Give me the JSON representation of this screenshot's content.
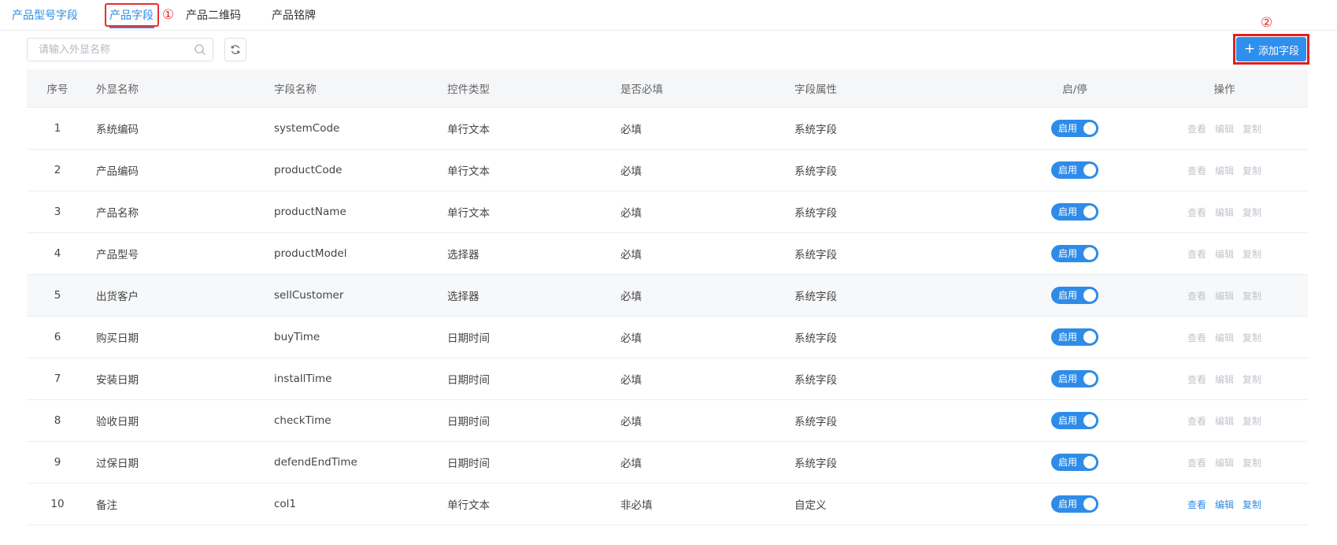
{
  "tabs": [
    {
      "label": "产品型号字段"
    },
    {
      "label": "产品字段"
    },
    {
      "label": "产品二维码"
    },
    {
      "label": "产品铭牌"
    }
  ],
  "annotations": {
    "marker1": "①",
    "marker2": "②"
  },
  "toolbar": {
    "search_placeholder": "请输入外显名称",
    "search_value": "",
    "add_label": "添加字段",
    "add_icon": "+"
  },
  "table": {
    "headers": [
      "序号",
      "外显名称",
      "字段名称",
      "控件类型",
      "是否必填",
      "字段属性",
      "启/停",
      "操作"
    ],
    "rows": [
      {
        "no": "1",
        "display": "系统编码",
        "field": "systemCode",
        "control": "单行文本",
        "required": "必填",
        "attr": "系统字段",
        "status": "启用",
        "ops": [
          "查看",
          "编辑",
          "复制"
        ],
        "editable": false
      },
      {
        "no": "2",
        "display": "产品编码",
        "field": "productCode",
        "control": "单行文本",
        "required": "必填",
        "attr": "系统字段",
        "status": "启用",
        "ops": [
          "查看",
          "编辑",
          "复制"
        ],
        "editable": false
      },
      {
        "no": "3",
        "display": "产品名称",
        "field": "productName",
        "control": "单行文本",
        "required": "必填",
        "attr": "系统字段",
        "status": "启用",
        "ops": [
          "查看",
          "编辑",
          "复制"
        ],
        "editable": false
      },
      {
        "no": "4",
        "display": "产品型号",
        "field": "productModel",
        "control": "选择器",
        "required": "必填",
        "attr": "系统字段",
        "status": "启用",
        "ops": [
          "查看",
          "编辑",
          "复制"
        ],
        "editable": false
      },
      {
        "no": "5",
        "display": "出货客户",
        "field": "sellCustomer",
        "control": "选择器",
        "required": "必填",
        "attr": "系统字段",
        "status": "启用",
        "ops": [
          "查看",
          "编辑",
          "复制"
        ],
        "editable": false
      },
      {
        "no": "6",
        "display": "购买日期",
        "field": "buyTime",
        "control": "日期时间",
        "required": "必填",
        "attr": "系统字段",
        "status": "启用",
        "ops": [
          "查看",
          "编辑",
          "复制"
        ],
        "editable": false
      },
      {
        "no": "7",
        "display": "安装日期",
        "field": "installTime",
        "control": "日期时间",
        "required": "必填",
        "attr": "系统字段",
        "status": "启用",
        "ops": [
          "查看",
          "编辑",
          "复制"
        ],
        "editable": false
      },
      {
        "no": "8",
        "display": "验收日期",
        "field": "checkTime",
        "control": "日期时间",
        "required": "必填",
        "attr": "系统字段",
        "status": "启用",
        "ops": [
          "查看",
          "编辑",
          "复制"
        ],
        "editable": false
      },
      {
        "no": "9",
        "display": "过保日期",
        "field": "defendEndTime",
        "control": "日期时间",
        "required": "必填",
        "attr": "系统字段",
        "status": "启用",
        "ops": [
          "查看",
          "编辑",
          "复制"
        ],
        "editable": false
      },
      {
        "no": "10",
        "display": "备注",
        "field": "col1",
        "control": "单行文本",
        "required": "非必填",
        "attr": "自定义",
        "status": "启用",
        "ops": [
          "查看",
          "编辑",
          "复制"
        ],
        "editable": true
      }
    ]
  },
  "colors": {
    "accent": "#2e8ce8",
    "highlight": "#e53030",
    "disabled_text": "#c0c4cc"
  }
}
